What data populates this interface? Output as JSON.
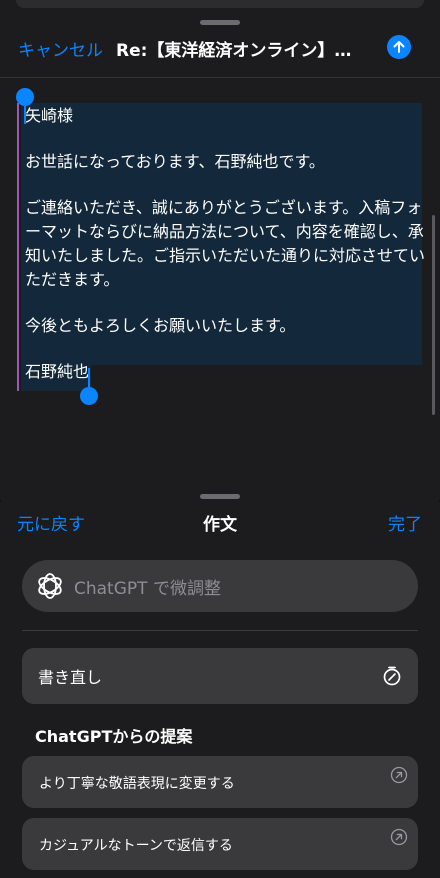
{
  "compose": {
    "cancel_label": "キャンセル",
    "subject": "Re:【東洋経済オンライン】矢…",
    "body_lines": [
      "矢崎様",
      "お世話になっております、石野純也です。",
      "ご連絡いただき、誠にありがとうございます。入稿フォーマットならびに納品方法について、内容を確認し、承知いたしました。ご指示いただいた通りに対応させていただきます。",
      "今後ともよろしくお願いいたします。",
      "石野純也"
    ]
  },
  "writing_tools": {
    "undo_label": "元に戻す",
    "title": "作文",
    "done_label": "完了",
    "chatgpt_placeholder": "ChatGPT で微調整",
    "rewrite_label": "書き直し",
    "suggestions_header": "ChatGPTからの提案",
    "suggestions": [
      {
        "label": "より丁寧な敬語表現に変更する"
      },
      {
        "label": "カジュアルなトーンで返信する"
      }
    ]
  },
  "colors": {
    "accent": "#0a84ff",
    "selection": "#13293b",
    "quote_bar": "#9b59b6"
  }
}
